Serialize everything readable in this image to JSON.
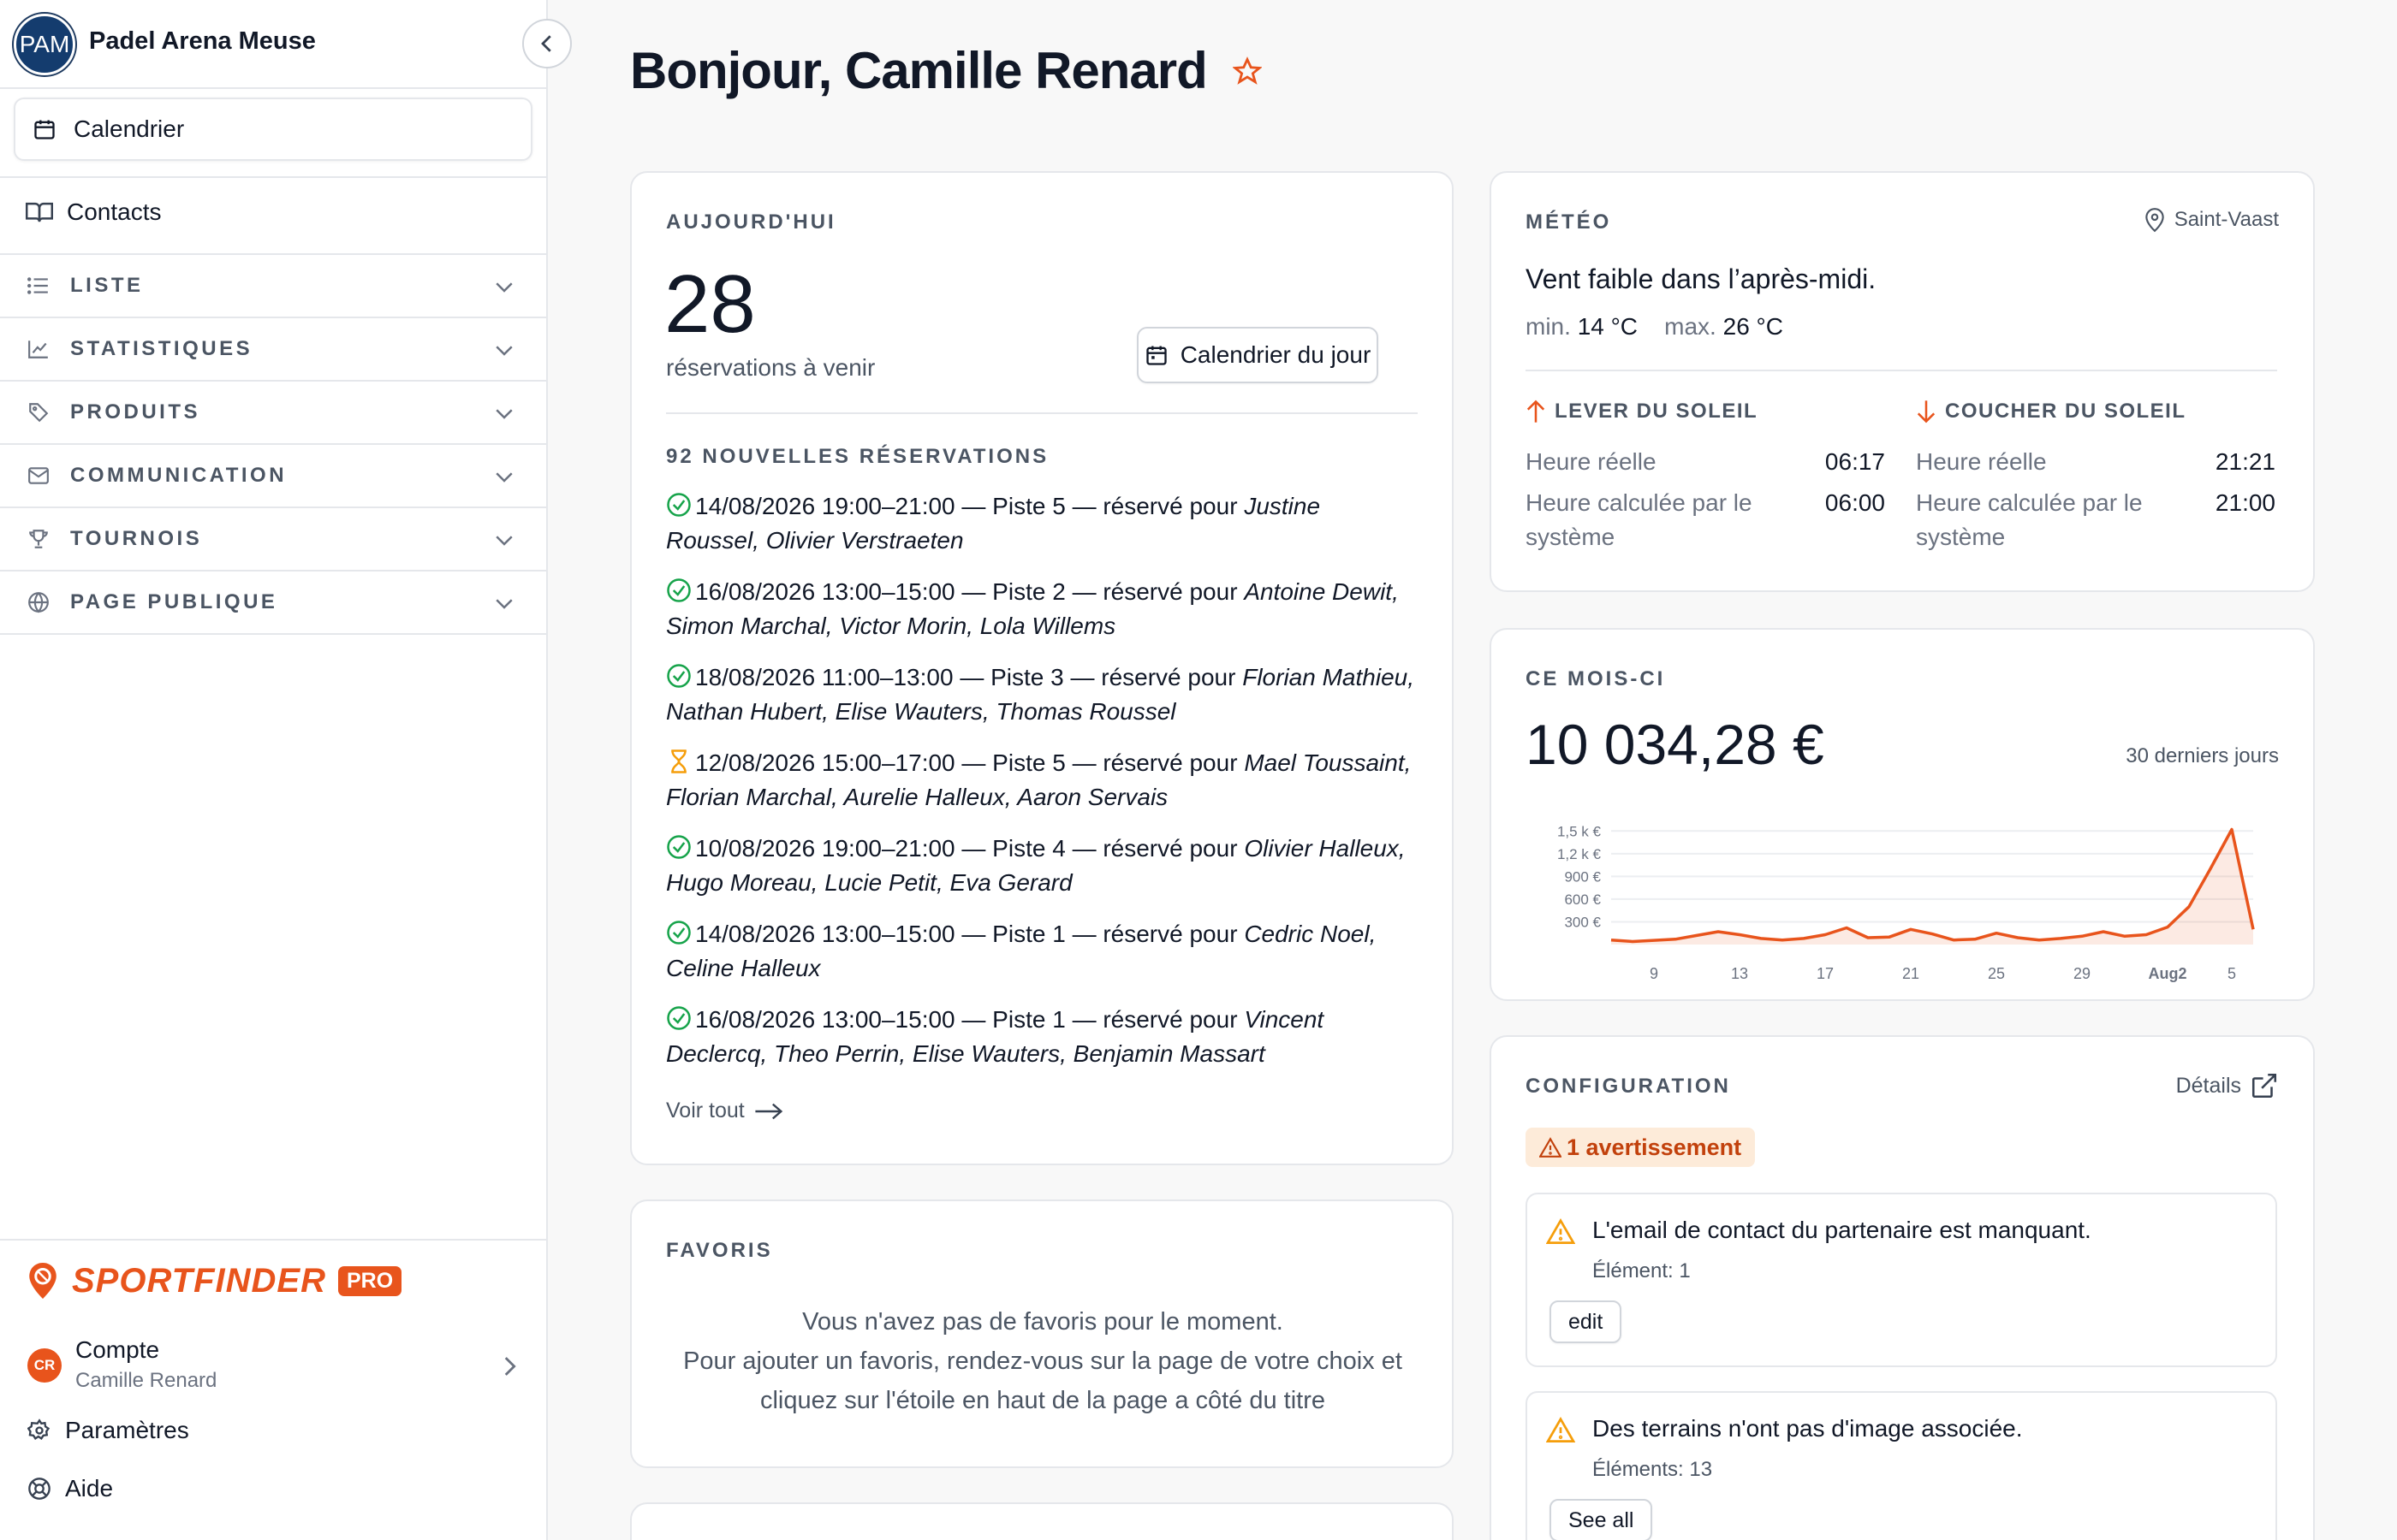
{
  "sidebar": {
    "avatar": "PAM",
    "club_name": "Padel Arena Meuse",
    "calendar": "Calendrier",
    "contacts": "Contacts",
    "sections": [
      {
        "label": "LISTE",
        "icon": "list-icon"
      },
      {
        "label": "STATISTIQUES",
        "icon": "chart-icon"
      },
      {
        "label": "PRODUITS",
        "icon": "tag-icon"
      },
      {
        "label": "COMMUNICATION",
        "icon": "mail-icon"
      },
      {
        "label": "TOURNOIS",
        "icon": "trophy-icon"
      },
      {
        "label": "PAGE PUBLIQUE",
        "icon": "globe-icon"
      }
    ],
    "brand": {
      "name": "SPORTFINDER",
      "badge": "PRO"
    },
    "account": {
      "initials": "CR",
      "label": "Compte",
      "user": "Camille Renard"
    },
    "settings": "Paramètres",
    "help": "Aide"
  },
  "page": {
    "title": "Bonjour, Camille Renard"
  },
  "today": {
    "caption": "AUJOURD'HUI",
    "count": "28",
    "count_label": "réservations à venir",
    "day_button": "Calendrier du jour",
    "new_caption": "92 NOUVELLES RÉSERVATIONS",
    "reservations": [
      {
        "status": "confirmed",
        "text": "14/08/2026 19:00–21:00 — Piste 5 — réservé pour ",
        "names": "Justine Roussel, Olivier Verstraeten"
      },
      {
        "status": "confirmed",
        "text": "16/08/2026 13:00–15:00 — Piste 2 — réservé pour ",
        "names": "Antoine Dewit, Simon Marchal, Victor Morin, Lola Willems"
      },
      {
        "status": "confirmed",
        "text": "18/08/2026 11:00–13:00 — Piste 3 — réservé pour ",
        "names": "Florian Mathieu, Nathan Hubert, Elise Wauters, Thomas Roussel"
      },
      {
        "status": "pending",
        "text": "12/08/2026 15:00–17:00 — Piste 5 — réservé pour ",
        "names": "Mael Toussaint, Florian Marchal, Aurelie Halleux, Aaron Servais"
      },
      {
        "status": "confirmed",
        "text": "10/08/2026 19:00–21:00 — Piste 4 — réservé pour ",
        "names": "Olivier Halleux, Hugo Moreau, Lucie Petit, Eva Gerard"
      },
      {
        "status": "confirmed",
        "text": "14/08/2026 13:00–15:00 — Piste 1 — réservé pour ",
        "names": "Cedric Noel, Celine Halleux"
      },
      {
        "status": "confirmed",
        "text": "16/08/2026 13:00–15:00 — Piste 1 — réservé pour ",
        "names": "Vincent Declercq, Theo Perrin, Elise Wauters, Benjamin Massart"
      }
    ],
    "see_all": "Voir tout"
  },
  "favorites": {
    "caption": "FAVORIS",
    "line1": "Vous n'avez pas de favoris pour le moment.",
    "line2": "Pour ajouter un favoris, rendez-vous sur la page de votre choix et",
    "line3": "cliquez sur l'étoile en haut de la page a côté du titre"
  },
  "weather": {
    "caption": "MÉTÉO",
    "location": "Saint-Vaast",
    "description": "Vent faible dans l’après-midi.",
    "min_label": "min.",
    "min": "14 °C",
    "max_label": "max.",
    "max": "26 °C",
    "sunrise": {
      "label": "LEVER DU SOLEIL",
      "real_label": "Heure réelle",
      "real": "06:17",
      "calc_label": "Heure calculée par le système",
      "calc": "06:00"
    },
    "sunset": {
      "label": "COUCHER DU SOLEIL",
      "real_label": "Heure réelle",
      "real": "21:21",
      "calc_label": "Heure calculée par le système",
      "calc": "21:00"
    }
  },
  "month": {
    "caption": "CE MOIS-CI",
    "amount": "10 034,28 €",
    "period": "30 derniers jours"
  },
  "chart_data": {
    "type": "area",
    "title": "",
    "xlabel": "",
    "ylabel": "",
    "x_ticks": [
      "9",
      "13",
      "17",
      "21",
      "25",
      "29",
      "Aug2",
      "5"
    ],
    "y_ticks": [
      "300 €",
      "600 €",
      "900 €",
      "1,2 k €",
      "1,5 k €"
    ],
    "ylim": [
      0,
      1650
    ],
    "x": [
      "7",
      "8",
      "9",
      "10",
      "11",
      "12",
      "13",
      "14",
      "15",
      "16",
      "17",
      "18",
      "19",
      "20",
      "21",
      "22",
      "23",
      "24",
      "25",
      "26",
      "27",
      "28",
      "29",
      "30",
      "31",
      "Aug1",
      "Aug2",
      "3",
      "4",
      "5"
    ],
    "values": [
      60,
      40,
      55,
      70,
      120,
      170,
      130,
      80,
      60,
      80,
      130,
      220,
      90,
      100,
      200,
      140,
      60,
      70,
      150,
      90,
      60,
      80,
      110,
      170,
      110,
      130,
      230,
      500,
      1000,
      1520,
      200
    ],
    "color": "#e8541c",
    "grid": true
  },
  "config": {
    "caption": "CONFIGURATION",
    "details": "Détails",
    "badge": "1 avertissement",
    "warnings": [
      {
        "title": "L'email de contact du partenaire est manquant.",
        "sub": "Élément: 1",
        "button": "edit"
      },
      {
        "title": "Des terrains n'ont pas d'image associée.",
        "sub": "Éléments: 13",
        "button": "See all"
      }
    ]
  }
}
